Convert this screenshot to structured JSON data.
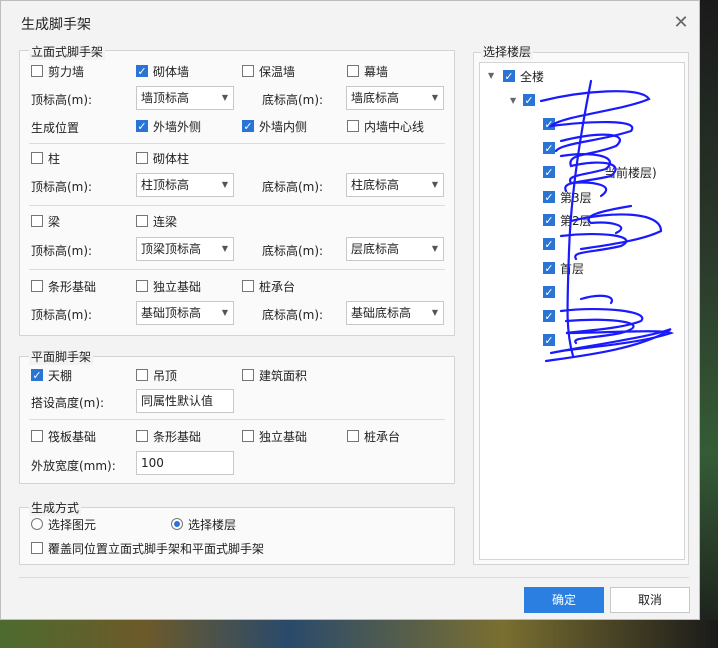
{
  "dialog": {
    "title": "生成脚手架",
    "close_icon": "close-icon"
  },
  "facade": {
    "label": "立面式脚手架",
    "walls": [
      {
        "label": "剪力墙",
        "checked": false
      },
      {
        "label": "砌体墙",
        "checked": true
      },
      {
        "label": "保温墙",
        "checked": false
      },
      {
        "label": "幕墙",
        "checked": false
      }
    ],
    "wall_top_label": "顶标高(m):",
    "wall_top_value": "墙顶标高",
    "wall_bottom_label": "底标高(m):",
    "wall_bottom_value": "墙底标高",
    "position_label": "生成位置",
    "positions": [
      {
        "label": "外墙外侧",
        "checked": true
      },
      {
        "label": "外墙内侧",
        "checked": true
      },
      {
        "label": "内墙中心线",
        "checked": false
      }
    ],
    "columns": [
      {
        "label": "柱",
        "checked": false
      },
      {
        "label": "砌体柱",
        "checked": false
      }
    ],
    "col_top_label": "顶标高(m):",
    "col_top_value": "柱顶标高",
    "col_bottom_label": "底标高(m):",
    "col_bottom_value": "柱底标高",
    "beams": [
      {
        "label": "梁",
        "checked": false
      },
      {
        "label": "连梁",
        "checked": false
      }
    ],
    "beam_top_label": "顶标高(m):",
    "beam_top_value": "顶梁顶标高",
    "beam_bottom_label": "底标高(m):",
    "beam_bottom_value": "层底标高",
    "foundations": [
      {
        "label": "条形基础",
        "checked": false
      },
      {
        "label": "独立基础",
        "checked": false
      },
      {
        "label": "桩承台",
        "checked": false
      }
    ],
    "found_top_label": "顶标高(m):",
    "found_top_value": "基础顶标高",
    "found_bottom_label": "底标高(m):",
    "found_bottom_value": "基础底标高"
  },
  "plane": {
    "label": "平面脚手架",
    "items": [
      {
        "label": "天棚",
        "checked": true
      },
      {
        "label": "吊顶",
        "checked": false
      },
      {
        "label": "建筑面积",
        "checked": false
      }
    ],
    "height_label": "搭设高度(m):",
    "height_value": "同属性默认值",
    "foundations": [
      {
        "label": "筏板基础",
        "checked": false
      },
      {
        "label": "条形基础",
        "checked": false
      },
      {
        "label": "独立基础",
        "checked": false
      },
      {
        "label": "桩承台",
        "checked": false
      }
    ],
    "width_label": "外放宽度(mm):",
    "width_value": "100"
  },
  "method": {
    "label": "生成方式",
    "options": [
      {
        "label": "选择图元",
        "selected": false
      },
      {
        "label": "选择楼层",
        "selected": true
      }
    ],
    "override_label": "覆盖同位置立面式脚手架和平面式脚手架",
    "override_checked": false
  },
  "floors": {
    "label": "选择楼层",
    "root": "全楼",
    "current_suffix": "当前楼层)",
    "floor3": "第3层",
    "floor2": "第2层",
    "floor1": "首层"
  },
  "buttons": {
    "ok": "确定",
    "cancel": "取消"
  },
  "colors": {
    "accent": "#2a74d6",
    "scribble": "#1a1aff"
  }
}
